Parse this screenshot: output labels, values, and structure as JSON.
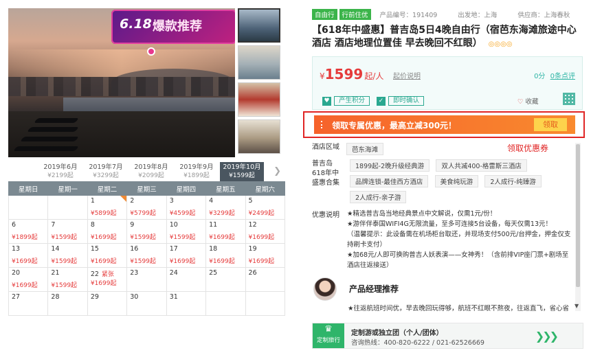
{
  "gallery": {
    "banner_num": "6.18",
    "banner_text": "爆款推荐",
    "thumbs": [
      "thumb-1",
      "thumb-2",
      "thumb-3",
      "thumb-4"
    ]
  },
  "months": [
    {
      "label": "2019年6月",
      "price": "¥2199起"
    },
    {
      "label": "2019年7月",
      "price": "¥3299起"
    },
    {
      "label": "2019年8月",
      "price": "¥2099起"
    },
    {
      "label": "2019年9月",
      "price": "¥1899起"
    },
    {
      "label": "2019年10月",
      "price": "¥1599起"
    }
  ],
  "weekdays": [
    "星期日",
    "星期一",
    "星期二",
    "星期三",
    "星期四",
    "星期五",
    "星期六"
  ],
  "calendar": [
    [
      {
        "d": "",
        "p": ""
      },
      {
        "d": "",
        "p": ""
      },
      {
        "d": "1",
        "p": "¥5899起",
        "corner": true
      },
      {
        "d": "2",
        "p": "¥5799起"
      },
      {
        "d": "3",
        "p": "¥4599起"
      },
      {
        "d": "4",
        "p": "¥3299起"
      },
      {
        "d": "5",
        "p": "¥2499起"
      }
    ],
    [
      {
        "d": "6",
        "p": "¥1899起"
      },
      {
        "d": "7",
        "p": "¥1599起"
      },
      {
        "d": "8",
        "p": "¥1699起"
      },
      {
        "d": "9",
        "p": "¥1599起"
      },
      {
        "d": "10",
        "p": "¥1599起"
      },
      {
        "d": "11",
        "p": "¥1699起"
      },
      {
        "d": "12",
        "p": "¥1699起"
      }
    ],
    [
      {
        "d": "13",
        "p": "¥1699起"
      },
      {
        "d": "14",
        "p": "¥1599起"
      },
      {
        "d": "15",
        "p": "¥1699起"
      },
      {
        "d": "16",
        "p": "¥1599起"
      },
      {
        "d": "17",
        "p": "¥1699起"
      },
      {
        "d": "18",
        "p": "¥1699起"
      },
      {
        "d": "19",
        "p": "¥1699起"
      }
    ],
    [
      {
        "d": "20",
        "p": "¥1699起"
      },
      {
        "d": "21",
        "p": "¥1599起"
      },
      {
        "d": "22",
        "p": "¥1699起",
        "tag": "紧张"
      },
      {
        "d": "23",
        "p": ""
      },
      {
        "d": "24",
        "p": ""
      },
      {
        "d": "25",
        "p": ""
      },
      {
        "d": "26",
        "p": ""
      }
    ],
    [
      {
        "d": "27",
        "p": ""
      },
      {
        "d": "28",
        "p": ""
      },
      {
        "d": "29",
        "p": ""
      },
      {
        "d": "30",
        "p": ""
      },
      {
        "d": "31",
        "p": ""
      },
      {
        "d": "",
        "p": ""
      },
      {
        "d": "",
        "p": ""
      }
    ]
  ],
  "product": {
    "tag1": "自由行",
    "tag2": "行前住优",
    "code": "产品编号：191409",
    "departure": "出发地：上海",
    "supplier": "供应商：上海春秋",
    "title": "【618年中盛惠】普吉岛5日4晚自由行（宿芭东海滩旅途中心酒店 酒店地理位置佳 早去晚回不红眼）",
    "stars": "◎◎◎◎"
  },
  "price": {
    "symbol": "¥",
    "amount": "1599",
    "unit": "起/人",
    "explain": "起价说明",
    "score": "0分",
    "reviews": "0条点评",
    "points_label": "产生积分",
    "confirm_label": "即时确认",
    "fav_label": "收藏"
  },
  "promo": {
    "text": "领取专属优惠，最高立减300元！",
    "button": "领取",
    "annotation": "领取优惠券"
  },
  "hotel_area": {
    "label": "酒店区域",
    "chip": "芭东海滩"
  },
  "packages": {
    "label": "普吉岛618年中盛惠合集",
    "chips": [
      "1899起-2晚升级经典游",
      "双人共减400-格雷斯三酒店",
      "品牌连锁-最佳西方酒店",
      "美食纯玩游",
      "2人成行-纯臻游",
      "2人成行-亲子游"
    ]
  },
  "offers": {
    "label": "优惠说明",
    "lines": [
      "★精选普吉岛当地经典景点中文解说，仅需1元/份！",
      "★游伴伴泰国WIFI4G无限流量，至多可连接5台设备，每天仅需13元！",
      "（温馨提示：此设备需在机场柜台取还，并现场支付500元/台押金，押金仅支持刷卡支付）",
      "★加68元/人即可换购普吉人妖表演——女神秀！（含前排VIP座门票+剧场至酒店往返接送）"
    ]
  },
  "manager": {
    "title": "产品经理推荐",
    "text": "★往返航班时间优，早去晚回玩得够，航班不红眼不熬夜，往返直飞，省心省"
  },
  "custom": {
    "icon_label": "定制旅行",
    "title": "定制游或独立团（个人/团体）",
    "phone": "咨询热线：400-820-6222 / 021-62526669"
  }
}
